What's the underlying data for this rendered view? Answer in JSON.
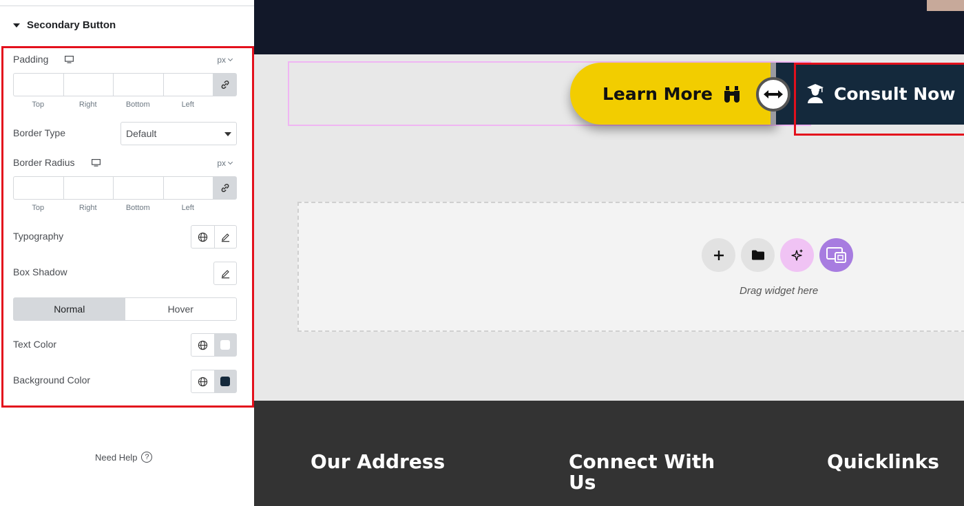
{
  "panel": {
    "section_title": "Secondary Button",
    "padding": {
      "label": "Padding",
      "unit": "px",
      "captions": [
        "Top",
        "Right",
        "Bottom",
        "Left"
      ]
    },
    "border_type": {
      "label": "Border Type",
      "value": "Default"
    },
    "border_radius": {
      "label": "Border Radius",
      "unit": "px",
      "captions": [
        "Top",
        "Right",
        "Bottom",
        "Left"
      ]
    },
    "typography": {
      "label": "Typography"
    },
    "box_shadow": {
      "label": "Box Shadow"
    },
    "tabs": {
      "normal": "Normal",
      "hover": "Hover"
    },
    "text_color": {
      "label": "Text Color",
      "swatch": "#ffffff"
    },
    "background_color": {
      "label": "Background Color",
      "swatch": "#14293c"
    },
    "need_help": "Need Help",
    "help_glyph": "?"
  },
  "canvas": {
    "learn_more": "Learn More",
    "consult_now": "Consult Now",
    "drop_zone_text": "Drag widget here",
    "footer": {
      "col1": "Our Address",
      "col2_line1": "Connect With",
      "col2_line2": "Us",
      "col3": "Quicklinks"
    }
  },
  "colors": {
    "accent_yellow": "#f2cd00",
    "navy": "#14293c",
    "header_bg": "#121829",
    "footer_bg": "#333333",
    "highlight_red": "#e3101c"
  },
  "icons": [
    "monitor-icon",
    "link-icon",
    "globe-icon",
    "pencil-icon",
    "binoculars-icon",
    "graduate-icon",
    "plus-icon",
    "folder-icon",
    "sparkle-icon",
    "template-icon",
    "help-icon"
  ]
}
